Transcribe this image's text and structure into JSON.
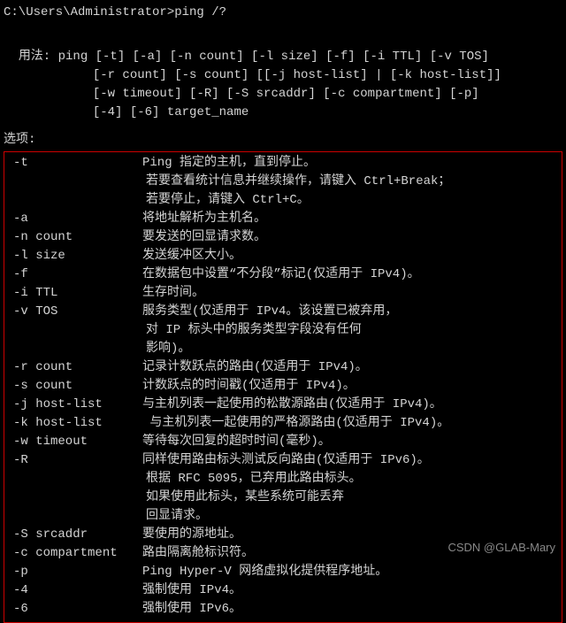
{
  "prompt": "C:\\Users\\Administrator>ping /?",
  "usage": {
    "label": "用法:",
    "lines": [
      "ping [-t] [-a] [-n count] [-l size] [-f] [-i TTL] [-v TOS]",
      "     [-r count] [-s count] [[-j host-list] | [-k host-list]]",
      "     [-w timeout] [-R] [-S srcaddr] [-c compartment] [-p]",
      "     [-4] [-6] target_name"
    ]
  },
  "options_label": "选项:",
  "options": [
    {
      "flag": "-t",
      "desc": "Ping 指定的主机，直到停止。",
      "cont": [
        "若要查看统计信息并继续操作，请键入 Ctrl+Break；",
        "若要停止，请键入 Ctrl+C。"
      ]
    },
    {
      "flag": "-a",
      "desc": "将地址解析为主机名。"
    },
    {
      "flag": "-n count",
      "desc": "要发送的回显请求数。"
    },
    {
      "flag": "-l size",
      "desc": "发送缓冲区大小。"
    },
    {
      "flag": "-f",
      "desc": "在数据包中设置“不分段”标记(仅适用于 IPv4)。"
    },
    {
      "flag": "-i TTL",
      "desc": "生存时间。"
    },
    {
      "flag": "-v TOS",
      "desc": "服务类型(仅适用于 IPv4。该设置已被弃用，",
      "cont": [
        "对 IP 标头中的服务类型字段没有任何",
        "影响)。"
      ]
    },
    {
      "flag": "-r count",
      "desc": "记录计数跃点的路由(仅适用于 IPv4)。"
    },
    {
      "flag": "-s count",
      "desc": "计数跃点的时间戳(仅适用于 IPv4)。"
    },
    {
      "flag": "-j host-list",
      "desc": "与主机列表一起使用的松散源路由(仅适用于 IPv4)。"
    },
    {
      "flag": "-k host-list",
      "desc": " 与主机列表一起使用的严格源路由(仅适用于 IPv4)。"
    },
    {
      "flag": "-w timeout",
      "desc": "等待每次回复的超时时间(毫秒)。"
    },
    {
      "flag": "-R",
      "desc": "同样使用路由标头测试反向路由(仅适用于 IPv6)。",
      "cont": [
        "根据 RFC 5095，已弃用此路由标头。",
        "如果使用此标头，某些系统可能丢弃",
        "回显请求。"
      ]
    },
    {
      "flag": "-S srcaddr",
      "desc": "要使用的源地址。"
    },
    {
      "flag": "-c compartment",
      "desc": "路由隔离舱标识符。"
    },
    {
      "flag": "-p",
      "desc": "Ping Hyper-V 网络虚拟化提供程序地址。"
    },
    {
      "flag": "-4",
      "desc": "强制使用 IPv4。"
    },
    {
      "flag": "-6",
      "desc": "强制使用 IPv6。"
    }
  ],
  "watermark": "CSDN @GLAB-Mary"
}
